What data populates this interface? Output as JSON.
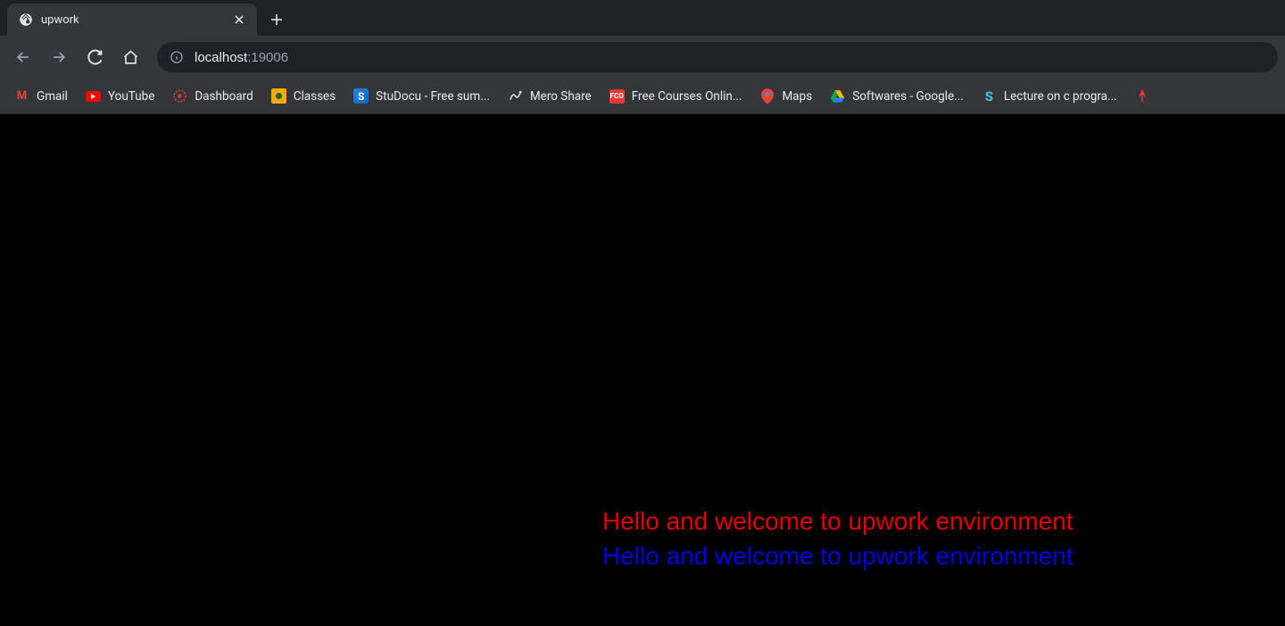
{
  "tab": {
    "title": "upwork"
  },
  "url": {
    "host": "localhost",
    "port": ":19006"
  },
  "bookmarks": [
    {
      "label": "Gmail",
      "icon": "gmail"
    },
    {
      "label": "YouTube",
      "icon": "youtube"
    },
    {
      "label": "Dashboard",
      "icon": "dashboard"
    },
    {
      "label": "Classes",
      "icon": "classes"
    },
    {
      "label": "StuDocu - Free sum...",
      "icon": "studocu"
    },
    {
      "label": "Mero Share",
      "icon": "meroshare"
    },
    {
      "label": "Free Courses Onlin...",
      "icon": "fco"
    },
    {
      "label": "Maps",
      "icon": "maps"
    },
    {
      "label": "Softwares - Google...",
      "icon": "drive"
    },
    {
      "label": "Lecture on c progra...",
      "icon": "lecture"
    }
  ],
  "content": {
    "line1": "Hello and welcome to upwork environment",
    "line2": "Hello and welcome to upwork environment"
  }
}
